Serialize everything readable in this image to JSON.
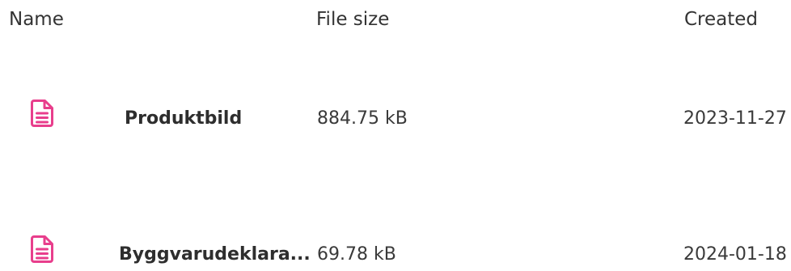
{
  "table": {
    "columns": [
      "Name",
      "File size",
      "Created"
    ],
    "rows": [
      {
        "icon": "document-icon",
        "name": "Produktbild",
        "size": "884.75 kB",
        "created": "2023-11-27"
      },
      {
        "icon": "document-icon",
        "name": "Byggvarudeklara...",
        "size": "69.78 kB",
        "created": "2024-01-18"
      }
    ]
  },
  "colors": {
    "icon_accent": "#e83e8c",
    "text": "#3a3a3a"
  }
}
